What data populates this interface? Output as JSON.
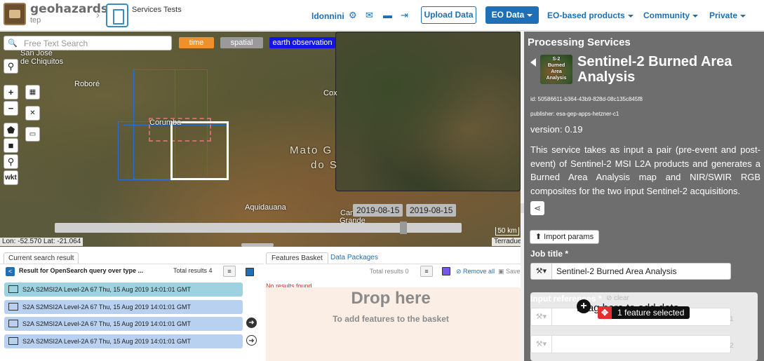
{
  "topbar": {
    "logo_name": "geohazards",
    "logo_sub": "tep",
    "service_breadcrumb": "Services Tests",
    "user": "ldonnini",
    "icons": [
      "gear-icon",
      "envelope-icon",
      "book-icon",
      "sign-out-icon"
    ],
    "upload_label": "Upload Data",
    "eo_data_label": "EO Data",
    "nav_links": [
      "EO-based products",
      "Community",
      "Private"
    ],
    "accent_color": "#1e6fb5"
  },
  "map": {
    "search_placeholder": "Free Text Search",
    "filters": [
      {
        "label": "time",
        "color": "#f0902a"
      },
      {
        "label": "spatial",
        "color": "#9a9a9a"
      },
      {
        "label": "earth observation",
        "color": "#1414e6"
      }
    ],
    "places": {
      "san_jose": "San José\nde Chiquitos",
      "robore": "Roboré",
      "corumba": "Corumba",
      "mato": "Mato G",
      "do": "do S",
      "cox": "Cox",
      "aquidauana": "Aquidauana",
      "campo": "Cam",
      "grande": "Grande"
    },
    "tools": [
      "wkt"
    ],
    "date_from": "2019-08-15",
    "date_to": "2019-08-15",
    "scale": "50 km",
    "coords": "Lon: -52.570 Lat: -21.064",
    "attribution": "Terradue"
  },
  "search_results": {
    "tab": "Current search result",
    "title": "Result for OpenSearch query over type ...",
    "total_label": "Total results",
    "total": "4",
    "rows": [
      "S2A S2MSI2A Level-2A 67 Thu, 15 Aug 2019 14:01:01 GMT",
      "S2A S2MSI2A Level-2A 67 Thu, 15 Aug 2019 14:01:01 GMT",
      "S2A S2MSI2A Level-2A 67 Thu, 15 Aug 2019 14:01:01 GMT",
      "S2A S2MSI2A Level-2A 67 Thu, 15 Aug 2019 14:01:01 GMT"
    ]
  },
  "basket": {
    "tab_active": "Features Basket",
    "tab_other": "Data Packages",
    "total_label": "Total results",
    "total": "0",
    "remove_all": "Remove all",
    "save": "Save",
    "no_results": "No results found.",
    "drop_title": "Drop here",
    "drop_sub": "To add features to the basket"
  },
  "processing": {
    "panel_title": "Processing Services",
    "thumb_text": "S-2\nBurned\nArea\nAnalysis",
    "service_name": "Sentinel-2 Burned Area Analysis",
    "id": "id: 50586611-b364-43b9-828d-08c135c845f8",
    "publisher": "publisher: esa-gep-apps-hetzner-c1",
    "version": "version: 0.19",
    "description": "This service takes as input a pair (pre-event and post-event) of Sentinel-2 MSI L2A products and generates a Burned Area Analysis map and NIR/SWIR RGB composites for the two input Sentinel-2 acquisitions.",
    "import_label": "Import params",
    "job_title_label": "Job title *",
    "job_title_value": "Sentinel-2 Burned Area Analysis",
    "input_ref_label": "Input references *",
    "clear_label": "clear",
    "drag_text": "Drag here to add data",
    "feature_selected": "1 feature selected",
    "ref_numbers": [
      "1",
      "2"
    ]
  }
}
